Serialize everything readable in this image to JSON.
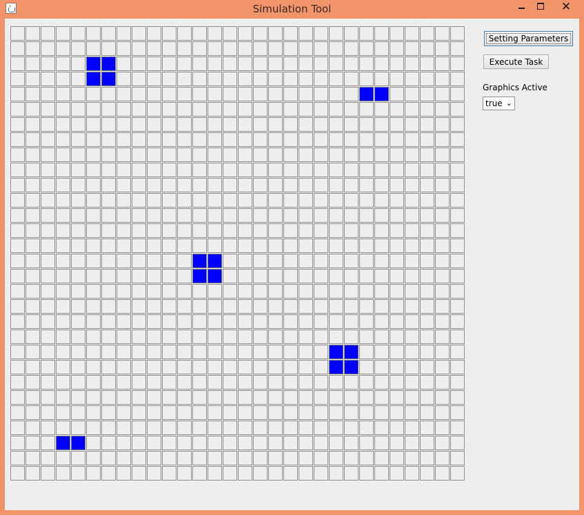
{
  "window": {
    "title": "Simulation Tool",
    "icon": "java-cup-icon",
    "controls": {
      "minimize": "minimize-icon",
      "maximize": "maximize-icon",
      "close": "close-icon"
    },
    "frame_color": "#f1946a"
  },
  "grid": {
    "columns": 30,
    "rows": 30,
    "cell_color": "#eeeeee",
    "active_color": "#0000ff",
    "active_cells": [
      [
        2,
        5
      ],
      [
        2,
        6
      ],
      [
        3,
        5
      ],
      [
        3,
        6
      ],
      [
        4,
        23
      ],
      [
        4,
        24
      ],
      [
        15,
        12
      ],
      [
        15,
        13
      ],
      [
        16,
        12
      ],
      [
        16,
        13
      ],
      [
        21,
        21
      ],
      [
        21,
        22
      ],
      [
        22,
        21
      ],
      [
        22,
        22
      ],
      [
        27,
        3
      ],
      [
        27,
        4
      ]
    ]
  },
  "controls": {
    "setting_parameters_label": "Setting Parameters",
    "execute_task_label": "Execute Task",
    "graphics_active_label": "Graphics Active",
    "graphics_active_value": "true"
  }
}
